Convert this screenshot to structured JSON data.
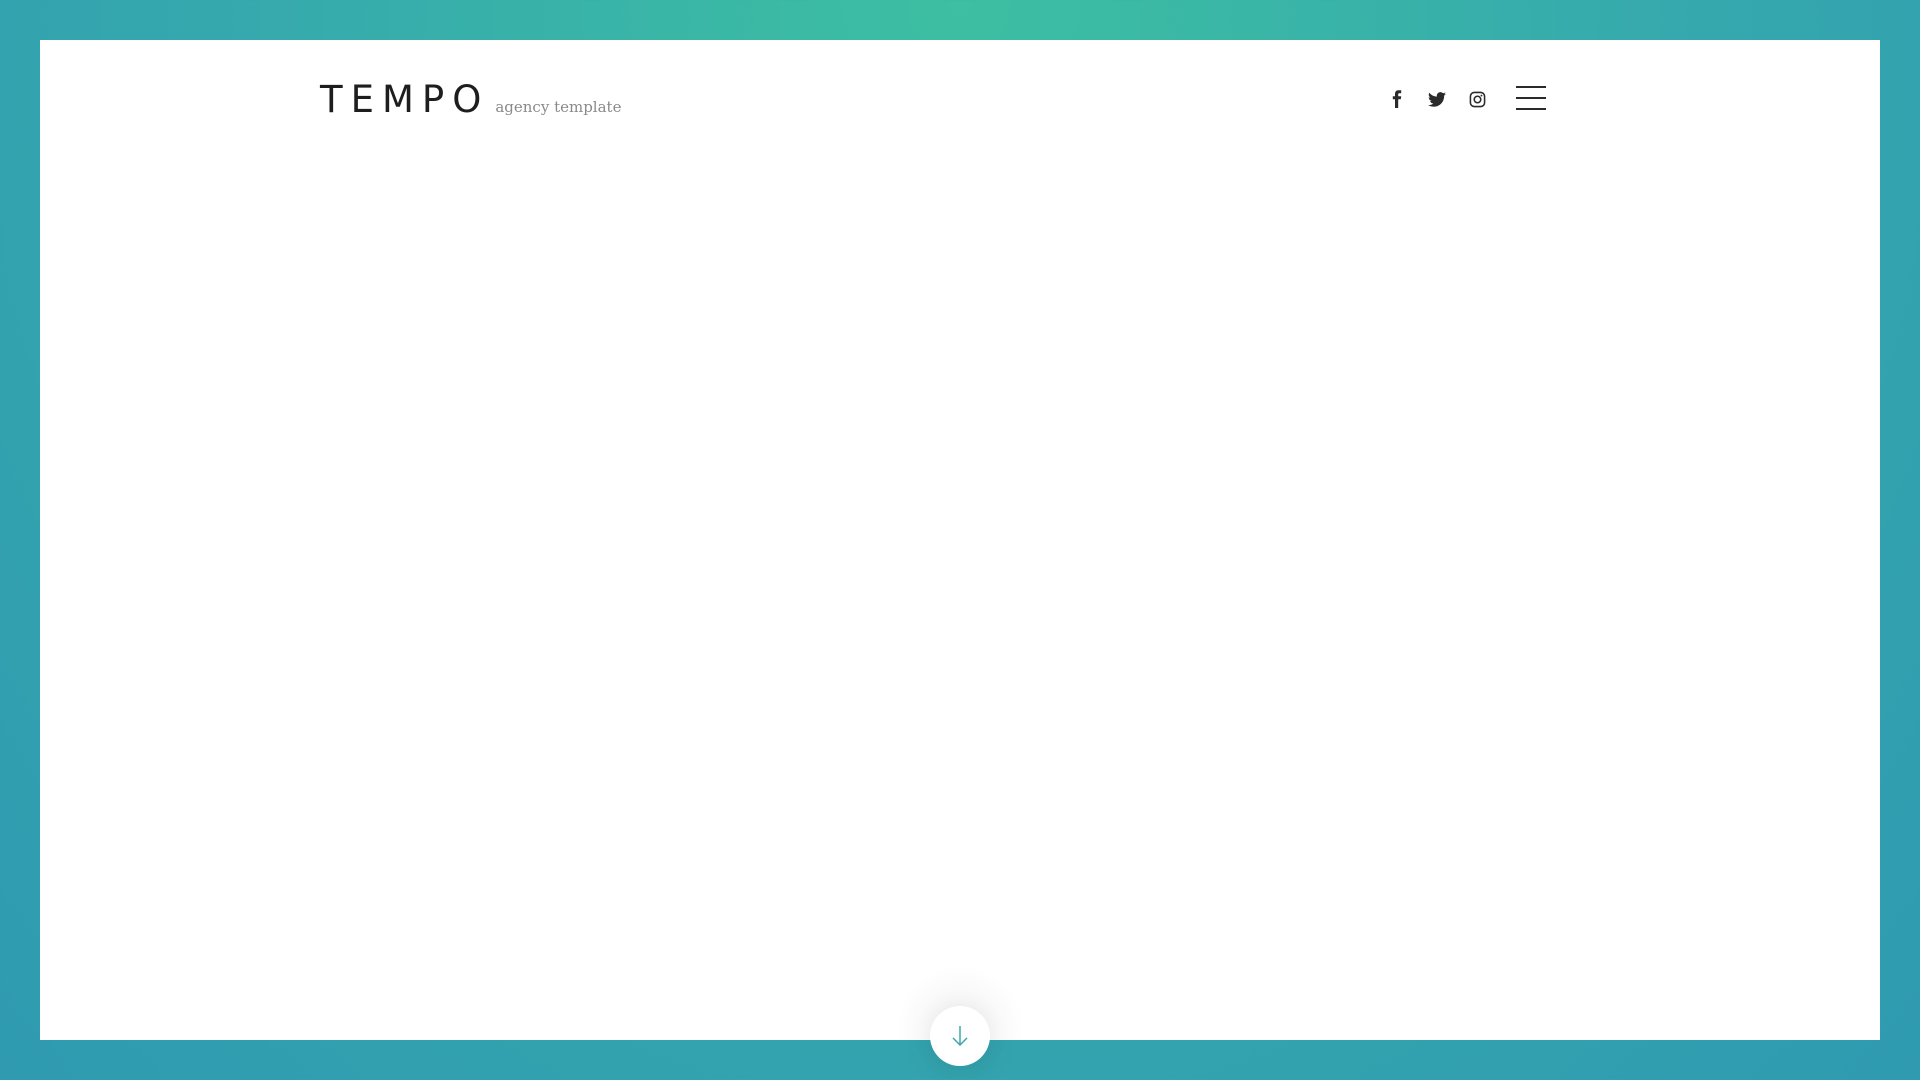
{
  "brand": {
    "name": "TEMPO",
    "tagline": "agency template"
  },
  "social": [
    {
      "icon": "facebook-icon"
    },
    {
      "icon": "twitter-icon"
    },
    {
      "icon": "instagram-icon"
    }
  ],
  "menu": {
    "icon": "hamburger-menu-icon"
  },
  "scroll": {
    "icon": "arrow-down-icon"
  },
  "colors": {
    "frame_gradient_start": "#3dbfa2",
    "frame_gradient_end": "#2f9ab0",
    "text_dark": "#1e1e1e",
    "tagline": "#8a8a8a",
    "accent_arrow": "#3aa7a8"
  }
}
